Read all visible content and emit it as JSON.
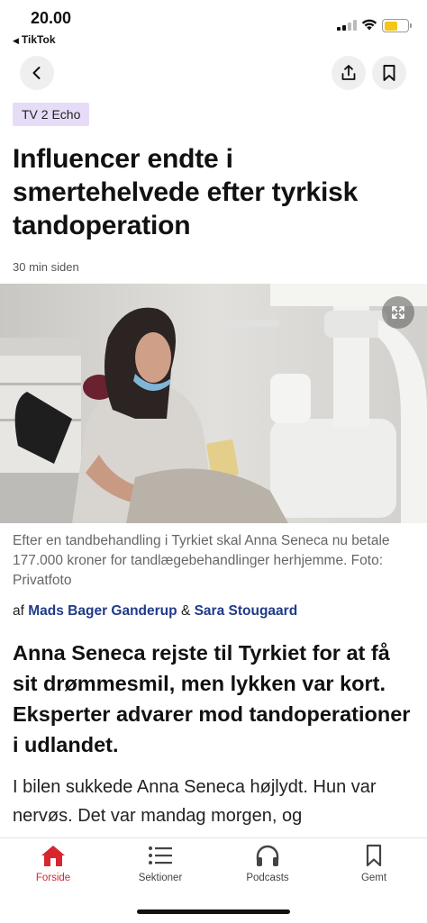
{
  "status_bar": {
    "time": "20.00",
    "back_app": "TikTok"
  },
  "toolbar": {
    "back_icon": "chevron-left-icon",
    "share_icon": "share-icon",
    "bookmark_icon": "bookmark-icon"
  },
  "article": {
    "category": "TV 2 Echo",
    "headline": "Influencer endte i smertehelvede efter tyrkisk tandoperation",
    "timestamp": "30 min siden",
    "caption": "Efter en tandbehandling i Tyrkiet skal Anna Seneca nu betale 177.000 kroner for tandlægebehandlinger herhjemme. Foto: Privatfoto",
    "byline_prefix": "af",
    "authors": [
      "Mads Bager Ganderup",
      "Sara Stougaard"
    ],
    "byline_separator": "&",
    "lead": "Anna Seneca rejste til Tyrkiet for at få sit drømmesmil, men lykken var kort. Eksperter advarer mod tandoperationer i udlandet.",
    "body": "I bilen sukkede Anna Seneca højlydt. Hun var nervøs. Det var mandag morgen, og"
  },
  "bottom_nav": {
    "items": [
      {
        "label": "Forside",
        "icon": "home-icon",
        "active": true
      },
      {
        "label": "Sektioner",
        "icon": "list-icon",
        "active": false
      },
      {
        "label": "Podcasts",
        "icon": "headphones-icon",
        "active": false
      },
      {
        "label": "Gemt",
        "icon": "bookmark-icon",
        "active": false
      }
    ]
  },
  "colors": {
    "accent": "#d7262e",
    "badge_bg": "#e7dcf7",
    "author_link": "#1f3a8a"
  }
}
